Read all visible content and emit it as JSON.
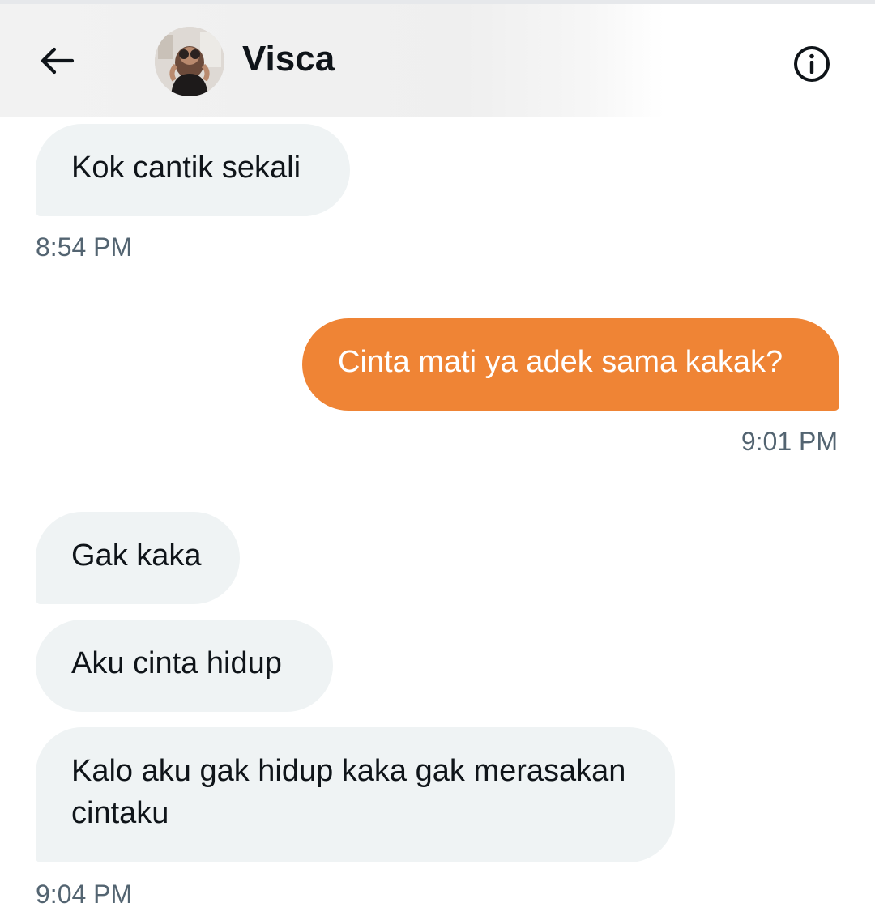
{
  "header": {
    "title": "Visca",
    "back_icon": "arrow-left-icon",
    "info_icon": "info-icon"
  },
  "colors": {
    "incoming_bubble": "#eff3f4",
    "outgoing_bubble": "#ef8435",
    "timestamp": "#536471",
    "text": "#0f1419"
  },
  "messages": [
    {
      "direction": "incoming",
      "text": "Kok cantik sekali"
    },
    {
      "direction": "incoming",
      "time": "8:54 PM"
    },
    {
      "direction": "outgoing",
      "text": "Cinta mati ya adek sama kakak?"
    },
    {
      "direction": "outgoing",
      "time": "9:01 PM"
    },
    {
      "direction": "incoming",
      "text": "Gak kaka"
    },
    {
      "direction": "incoming",
      "text": "Aku cinta hidup"
    },
    {
      "direction": "incoming",
      "text": "Kalo aku gak hidup kaka gak merasakan cintaku"
    },
    {
      "direction": "incoming",
      "time": "9:04 PM"
    }
  ]
}
